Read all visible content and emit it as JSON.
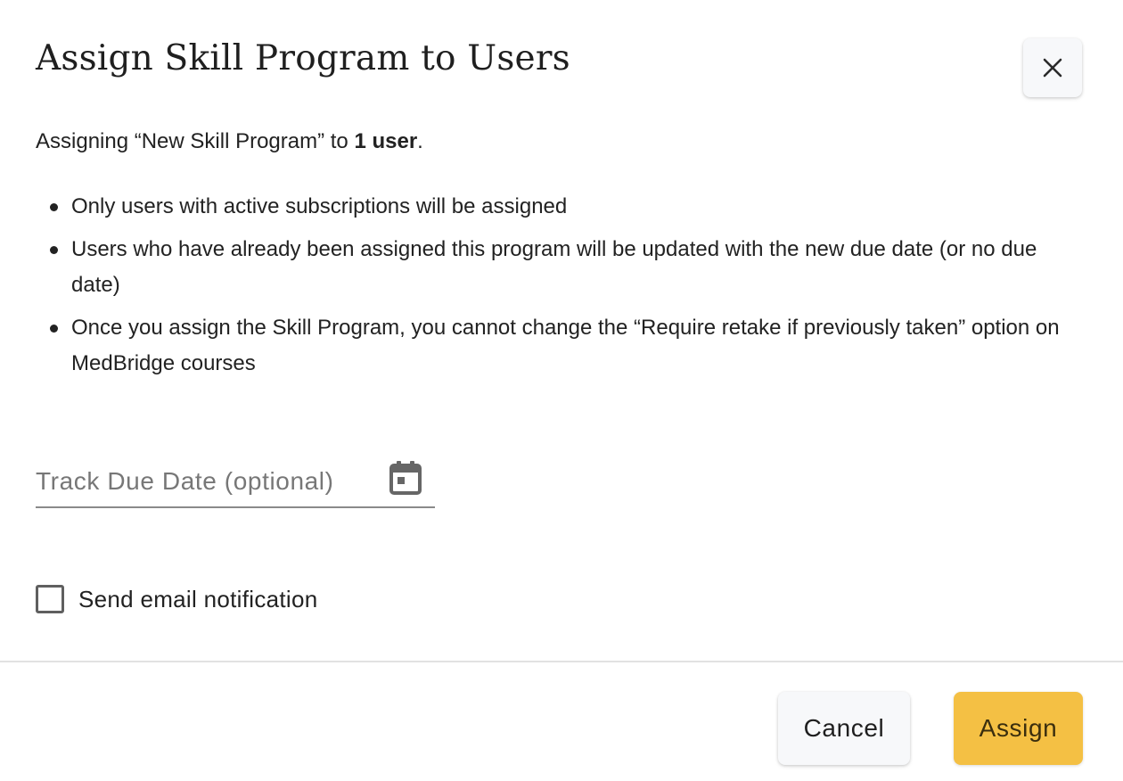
{
  "dialog": {
    "title": "Assign Skill Program to Users",
    "close_icon": "close-icon",
    "intro": {
      "prefix": "Assigning “New Skill Program” to ",
      "count_bold": "1 user",
      "suffix": "."
    },
    "bullets": [
      "Only users with active subscriptions will be assigned",
      "Users who have already been assigned this program will be updated with the new due date (or no due date)",
      "Once you assign the Skill Program, you cannot change the “Require retake if previously taken” option on MedBridge courses"
    ]
  },
  "due_date_field": {
    "placeholder": "Track Due Date (optional)",
    "value": "",
    "icon": "calendar-icon"
  },
  "email_notification": {
    "label": "Send email notification",
    "checked": false
  },
  "footer": {
    "cancel_label": "Cancel",
    "assign_label": "Assign"
  },
  "colors": {
    "primary_button": "#f4c044",
    "secondary_button": "#f7f8fa",
    "divider": "#e2e2e2"
  }
}
